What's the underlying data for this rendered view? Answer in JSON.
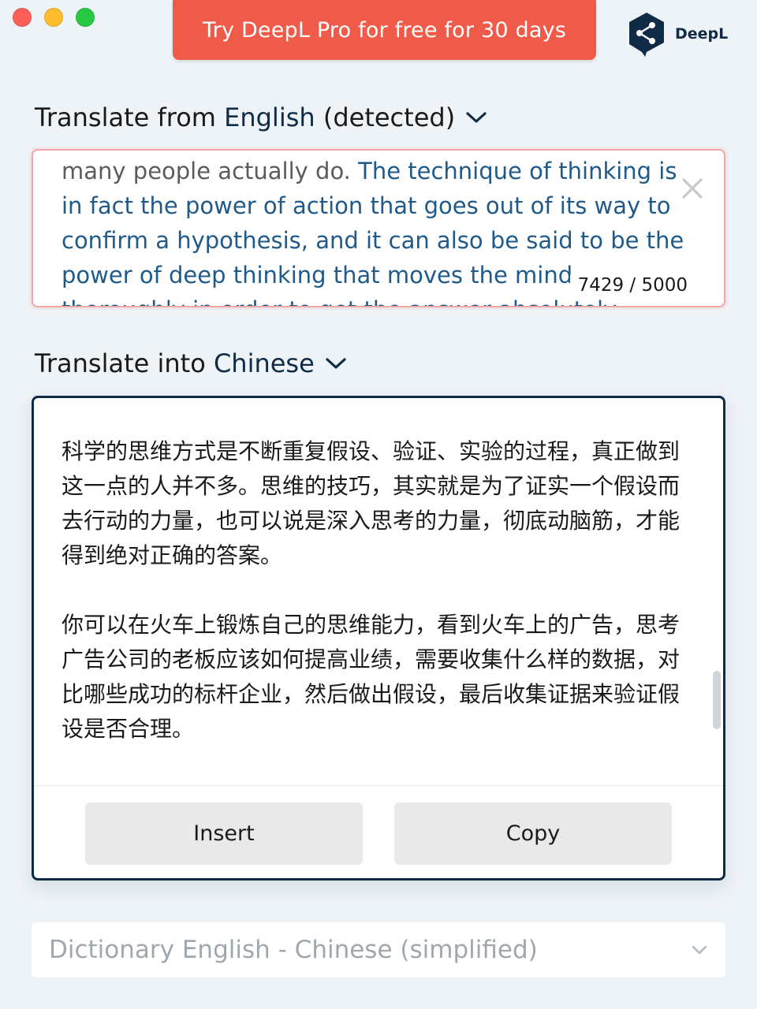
{
  "window": {
    "controls": [
      "close",
      "minimize",
      "zoom"
    ]
  },
  "promo": {
    "label": "Try DeepL Pro for free for 30 days",
    "color": "#f05a48"
  },
  "brand": {
    "name": "DeepL",
    "icon": "deepl-logo-icon",
    "color": "#0f2b46"
  },
  "source": {
    "prefix": "Translate from",
    "language": "English",
    "suffix": "(detected)",
    "text_muted": "many people actually do.",
    "text_highlight": "The technique of thinking is in fact the power of action that goes out of its way to confirm a hypothesis, and it can also be said to be the power of deep thinking that moves the mind thoroughly in order to get the answer absolutely",
    "counter": "7429 / 5000",
    "clear_icon": "close-icon",
    "border_color": "#f1a6a6"
  },
  "target": {
    "prefix": "Translate into",
    "language": "Chinese",
    "paragraphs": [
      "科学的思维方式是不断重复假设、验证、实验的过程，真正做到这一点的人并不多。思维的技巧，其实就是为了证实一个假设而去行动的力量，也可以说是深入思考的力量，彻底动脑筋，才能得到绝对正确的答案。",
      "你可以在火车上锻炼自己的思维能力，看到火车上的广告，思考广告公司的老板应该如何提高业绩，需要收集什么样的数据，对比哪些成功的标杆企业，然后做出假设，最后收集证据来验证假设是否合理。"
    ],
    "insert_label": "Insert",
    "copy_label": "Copy"
  },
  "dictionary": {
    "label": "Dictionary English - Chinese (simplified)"
  }
}
